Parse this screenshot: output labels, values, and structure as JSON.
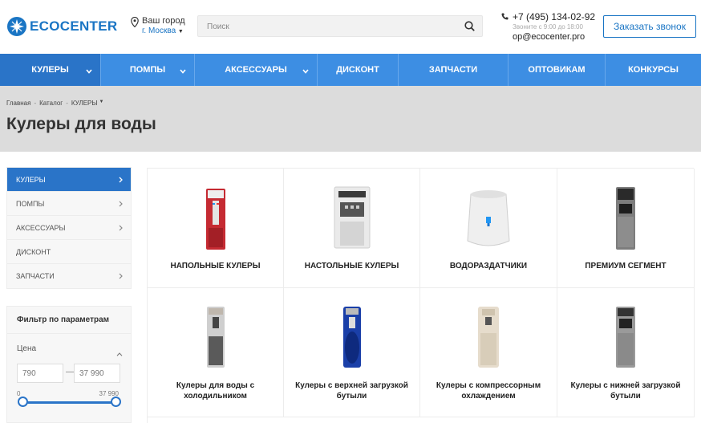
{
  "header": {
    "logo_text": "ECOCENTER",
    "city_label": "Ваш город",
    "city_value": "г. Москва",
    "search_placeholder": "Поиск",
    "phone": "+7 (495) 134-02-92",
    "hours": "Звоните с 9:00 до 18:00",
    "email": "op@ecocenter.pro",
    "callback_label": "Заказать звонок"
  },
  "nav": {
    "items": [
      {
        "label": "КУЛЕРЫ"
      },
      {
        "label": "ПОМПЫ"
      },
      {
        "label": "АКСЕССУАРЫ"
      },
      {
        "label": "ДИСКОНТ"
      },
      {
        "label": "ЗАПЧАСТИ"
      },
      {
        "label": "ОПТОВИКАМ"
      },
      {
        "label": "КОНКУРСЫ"
      }
    ]
  },
  "breadcrumb": [
    "Главная",
    "Каталог",
    "КУЛЕРЫ"
  ],
  "page_title": "Кулеры для воды",
  "sidebar": {
    "items": [
      {
        "label": "КУЛЕРЫ"
      },
      {
        "label": "ПОМПЫ"
      },
      {
        "label": "АКСЕССУАРЫ"
      },
      {
        "label": "ДИСКОНТ"
      },
      {
        "label": "ЗАПЧАСТИ"
      }
    ]
  },
  "filter": {
    "title": "Фильтр по параметрам",
    "price_label": "Цена",
    "price_from": "790",
    "price_to": "37 990",
    "range_min": "0",
    "range_max": "37 990"
  },
  "categories": [
    {
      "name": "НАПОЛЬНЫЕ КУЛЕРЫ"
    },
    {
      "name": "НАСТОЛЬНЫЕ КУЛЕРЫ"
    },
    {
      "name": "ВОДОРАЗДАТЧИКИ"
    },
    {
      "name": "ПРЕМИУМ СЕГМЕНТ"
    }
  ],
  "subcategories": [
    {
      "name": "Кулеры для воды с холодильником"
    },
    {
      "name": "Кулеры с верхней загрузкой бутыли"
    },
    {
      "name": "Кулеры с компрессорным охлаждением"
    },
    {
      "name": "Кулеры с нижней загрузкой бутыли"
    }
  ],
  "colors": {
    "brand": "#1a75c4",
    "nav": "#3d8ee3",
    "nav_active": "#2a74c8"
  }
}
